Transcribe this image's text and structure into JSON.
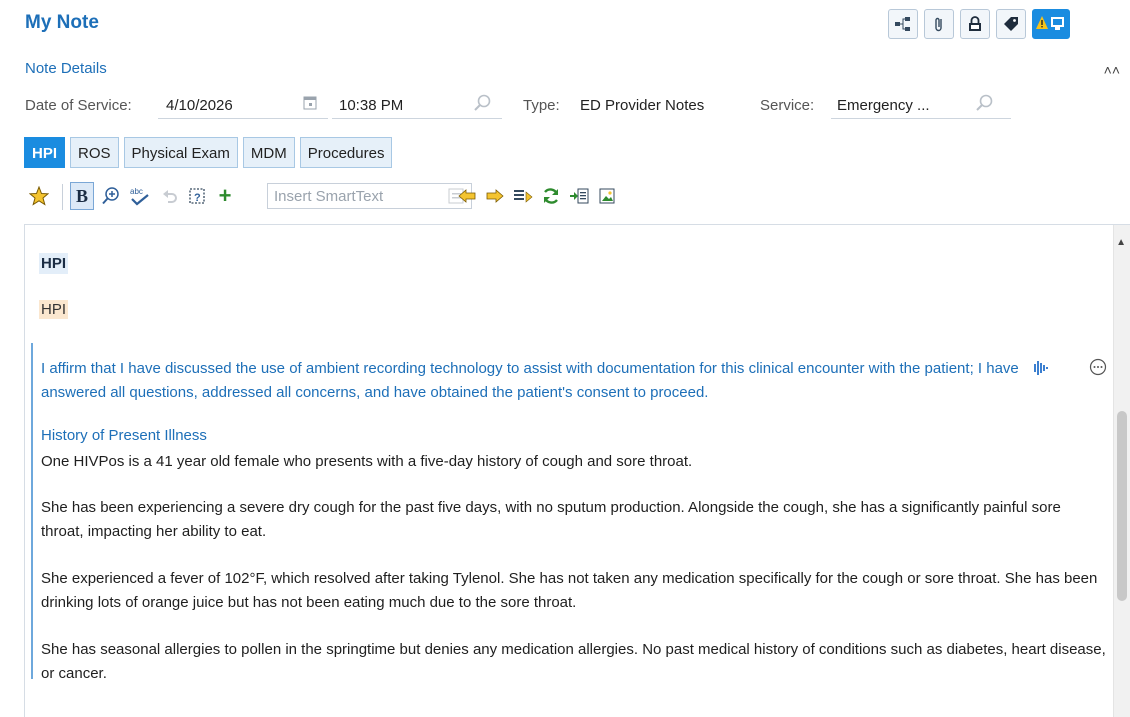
{
  "header": {
    "title": "My Note",
    "icons": [
      "share-icon",
      "attachment-icon",
      "lock-icon",
      "tag-icon",
      "alert-icon",
      "reader-icon"
    ]
  },
  "note_details": {
    "section_title": "Note Details",
    "date_label": "Date of Service:",
    "date_value": "4/10/2026",
    "time_value": "10:38 PM",
    "type_label": "Type:",
    "type_value": "ED Provider Notes",
    "service_label": "Service:",
    "service_value": "Emergency ..."
  },
  "tabs": [
    "HPI",
    "ROS",
    "Physical Exam",
    "MDM",
    "Procedures"
  ],
  "toolbar": {
    "smarttext_placeholder": "Insert SmartText"
  },
  "editor": {
    "hpi_heading": "HPI",
    "hpi_text": "HPI",
    "affirmation": "I affirm that I have discussed the use of ambient recording technology to assist with documentation for this clinical encounter with the patient; I have answered all questions, addressed all concerns, and have obtained the patient's consent to proceed.",
    "hpi_section_title": "History of Present Illness",
    "paragraphs": [
      "One HIVPos is a 41 year old female who presents with a five-day history of cough and sore throat.",
      "She has been experiencing a severe dry cough for the past five days, with no sputum production. Alongside the cough, she has a significantly painful sore throat, impacting her ability to eat.",
      "She experienced a fever of 102°F, which resolved after taking Tylenol. She has not taken any medication specifically for the cough or sore throat. She has been drinking lots of orange juice but has not been eating much due to the sore throat.",
      "She has seasonal allergies to pollen in the springtime but denies any medication allergies. No past medical history of conditions such as diabetes, heart disease, or cancer."
    ]
  },
  "colors": {
    "accent": "#1a8ce0",
    "link_blue": "#1d6fb8",
    "hpi_highlight": "#fbe7cf"
  }
}
